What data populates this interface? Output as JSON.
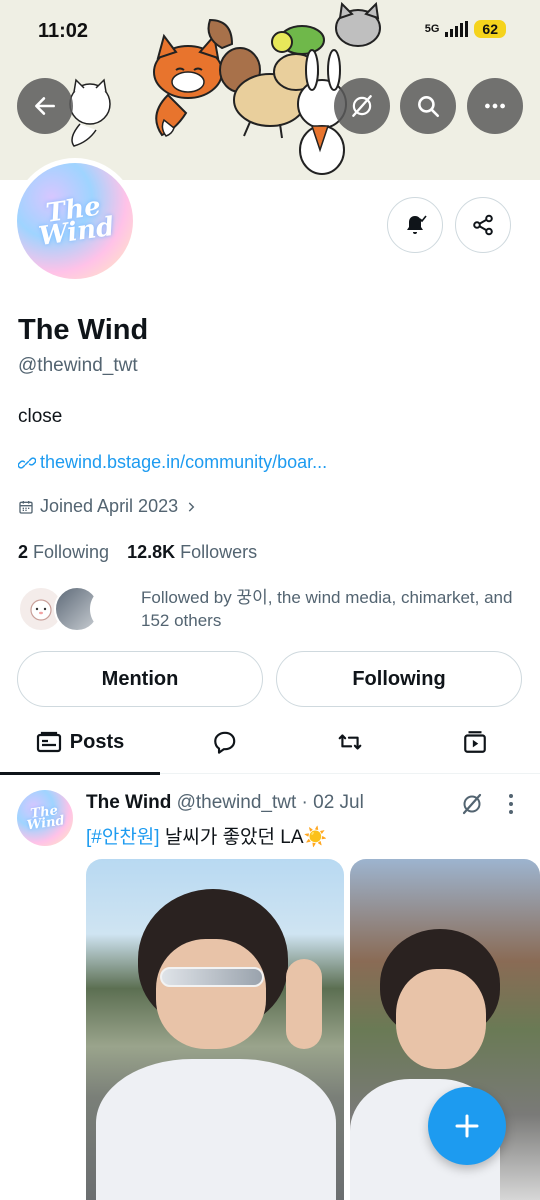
{
  "status_bar": {
    "time": "11:02",
    "network": "5G",
    "battery": "62"
  },
  "profile": {
    "display_name": "The Wind",
    "handle": "@thewind_twt",
    "avatar_text": "The Wind",
    "bio": "close",
    "link": "thewind.bstage.in/community/boar...",
    "joined": "Joined April 2023",
    "following_count": "2",
    "following_label": "Following",
    "followers_count": "12.8K",
    "followers_label": "Followers",
    "followed_by": "Followed by 꿍이, the wind media, chimarket, and 152 others"
  },
  "actions": {
    "mention_label": "Mention",
    "following_label": "Following"
  },
  "tabs": [
    {
      "label": "Posts",
      "active": true,
      "icon": "posts-icon"
    },
    {
      "label": "",
      "icon": "replies-icon"
    },
    {
      "label": "",
      "icon": "retweet-icon"
    },
    {
      "label": "",
      "icon": "media-icon"
    }
  ],
  "post": {
    "author": "The Wind",
    "handle": "@thewind_twt",
    "separator": "·",
    "date": "02 Jul",
    "hashtag": "[#안찬원]",
    "text": " 날씨가 좋았던 LA☀️"
  },
  "colors": {
    "accent": "#1d9bf0",
    "banner_bg": "#efefe4",
    "overlay_button": "#5a5a5a"
  }
}
